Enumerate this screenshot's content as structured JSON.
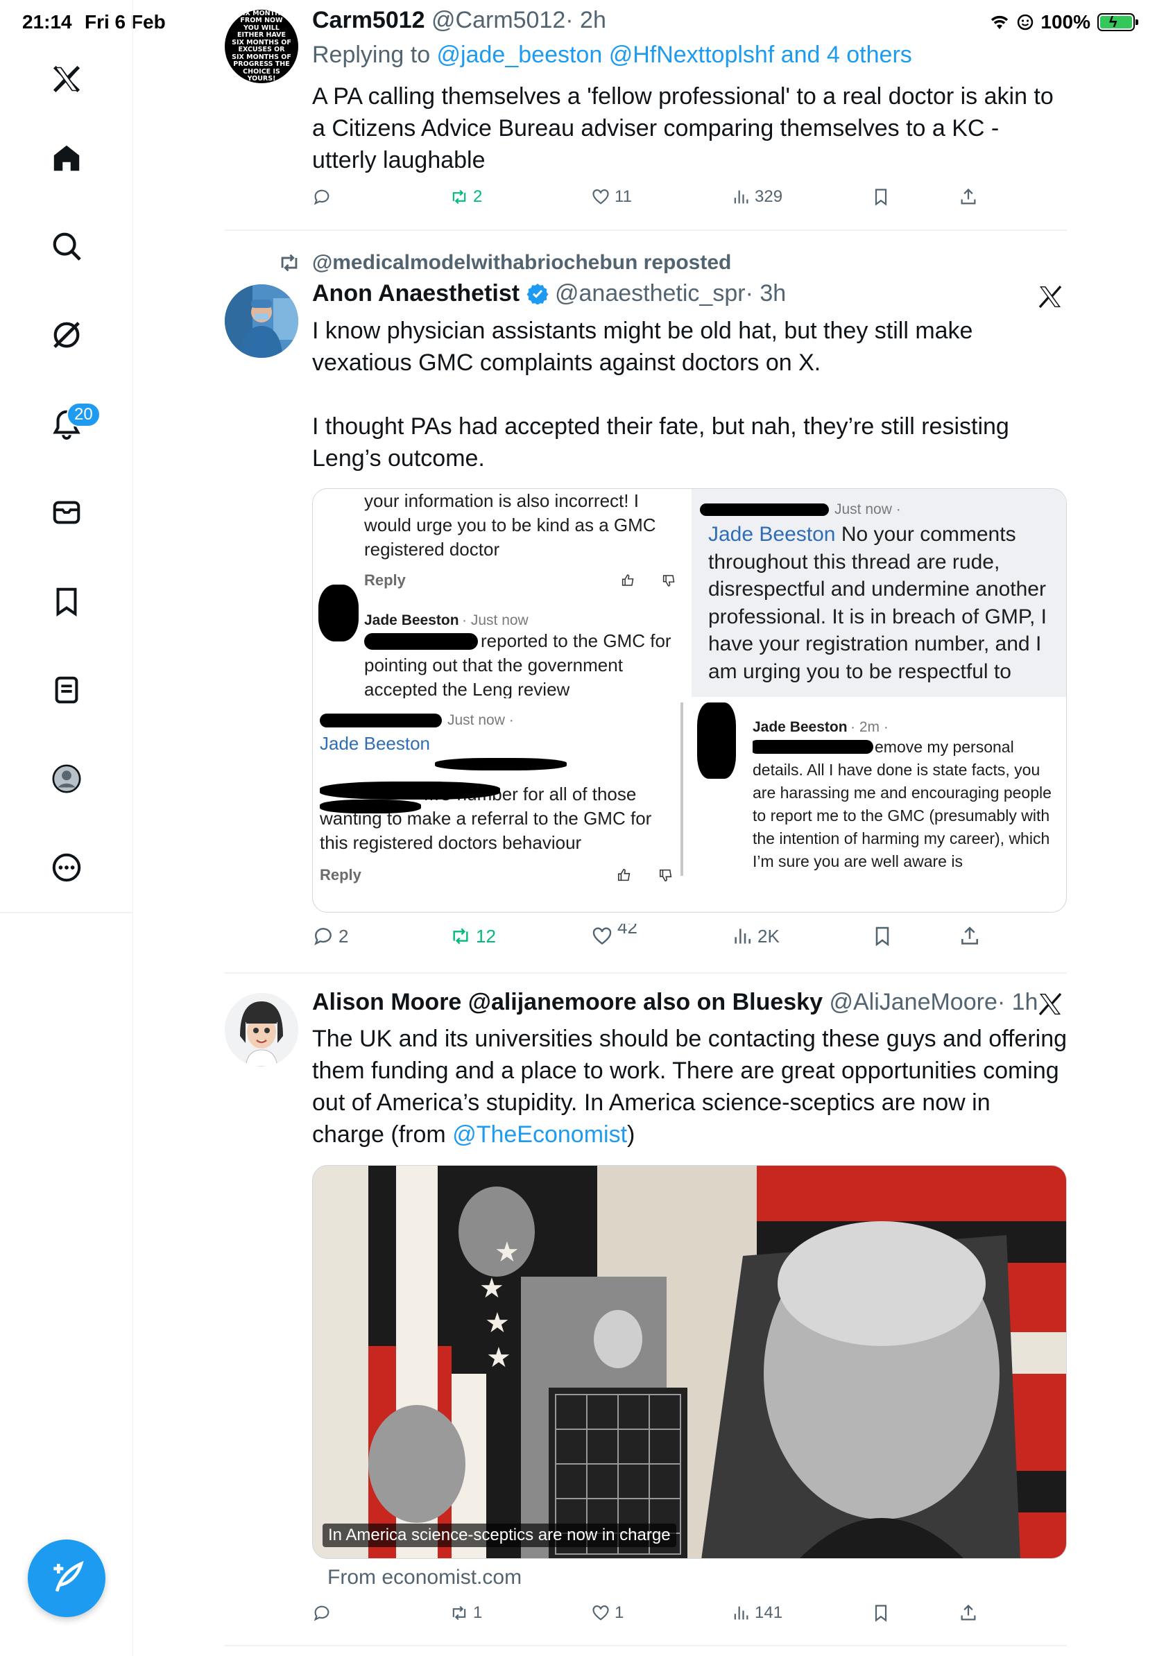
{
  "status_bar": {
    "time": "21:14",
    "date": "Fri 6 Feb",
    "battery": "100%",
    "battery_level": 1.0
  },
  "sidebar": {
    "items": [
      {
        "icon": "x-logo-icon"
      },
      {
        "icon": "home-icon"
      },
      {
        "icon": "search-icon"
      },
      {
        "icon": "grok-icon"
      },
      {
        "icon": "bell-icon",
        "badge": "20"
      },
      {
        "icon": "mail-icon"
      },
      {
        "icon": "bookmark-icon"
      },
      {
        "icon": "lists-icon"
      },
      {
        "icon": "profile-icon"
      },
      {
        "icon": "more-icon"
      }
    ],
    "compose_icon": "compose-icon"
  },
  "tweets": [
    {
      "display_name": "Carm5012",
      "handle": "@Carm5012",
      "time": "· 2h",
      "reply_prefix": "Replying to ",
      "reply_to": "@jade_beeston @HfNexttoplshf and 4 others",
      "avatar_text": "SIX MONTHS FROM NOW YOU WILL EITHER HAVE SIX MONTHS OF EXCUSES OR SIX MONTHS OF PROGRESS THE CHOICE IS YOURS!",
      "body": "A PA calling themselves a 'fellow professional' to a real doctor is akin to a Citizens Advice Bureau adviser comparing themselves to a KC - utterly laughable",
      "stats": {
        "replies": "",
        "reposts": "2",
        "likes": "11",
        "views": "329"
      }
    },
    {
      "repost_label": "@medicalmodelwithabriochebun reposted",
      "display_name": "Anon Anaesthetist",
      "handle": "@anaesthetic_spr",
      "time": "· 3h",
      "body_p1": "I know physician assistants might be old hat, but they still make vexatious GMC complaints against doctors on X.",
      "body_p2": "I thought PAs had accepted their fate, but nah, they’re still resisting Leng’s outcome.",
      "screenshot": {
        "q1_text": "your information is also incorrect! I would urge you to be kind as a GMC registered doctor",
        "q1_reply": "Reply",
        "q2_name": "Jade Beeston",
        "q2_meta": "· Just now",
        "q2_text": "reported to the GMC for pointing out that the government accepted the Leng review",
        "q3_meta": "Just now ·",
        "q3_link": "Jade Beeston",
        "q3_text": "No your comments throughout this thread are rude, disrespectful and undermine another professional. It is in breach of GMP, I have your registration number, and I am urging you to be respectful to",
        "q4_meta": "Just now ·",
        "q4_link": "Jade Beeston",
        "q4_text": "MC number for all of those wanting to make a referral to the GMC for this registered doctors behaviour",
        "q4_reply": "Reply",
        "q5_name": "Jade Beeston",
        "q5_meta": "· 2m ·",
        "q5_text": "emove my personal details. All I have done is state facts, you are harassing me and encouraging people to report me to the GMC (presumably with the intention of harming my career), which I’m sure you are well aware is"
      },
      "stats": {
        "replies": "2",
        "reposts": "12",
        "likes": "42",
        "views": "2K"
      }
    },
    {
      "display_name": "Alison Moore @alijanemoore also on Bluesky",
      "handle": "@AliJaneMoore",
      "time": "· 1h",
      "body": "The UK and its universities should be contacting these guys and offering them funding and a place to work. There are great opportunities coming out of America’s stupidity. In America science-sceptics are now in charge (from ",
      "body_link": "@TheEconomist",
      "body_end": ")",
      "media_caption": "In America science-sceptics are now in charge",
      "link_source": "From economist.com",
      "stats": {
        "replies": "",
        "reposts": "1",
        "likes": "1",
        "views": "141"
      }
    }
  ],
  "colors": {
    "accent": "#1d9bf0",
    "text": "#0f1419",
    "secondary": "#536471",
    "repost_green": "#00ba7c",
    "separator": "#eff3f4"
  }
}
